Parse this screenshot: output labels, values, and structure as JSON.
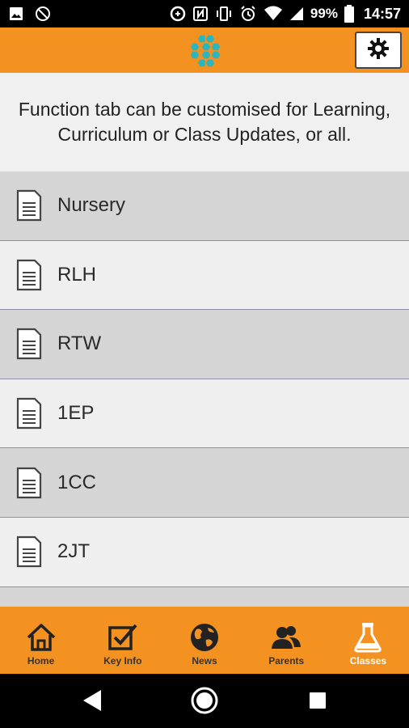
{
  "status_bar": {
    "battery_percent": "99%",
    "time": "14:57",
    "icons": [
      "image-icon",
      "rotation-lock-icon",
      "data-saver-icon",
      "nfc-icon",
      "vibrate-icon",
      "alarm-icon",
      "wifi-icon",
      "signal-icon",
      "battery-icon"
    ]
  },
  "header": {
    "logo": "hexagon-cluster-logo",
    "settings_icon": "gear-icon",
    "brand_color": "#f39221"
  },
  "banner": {
    "text": "Function tab can be customised for Learning, Curriculum or Class Updates, or all."
  },
  "classes": [
    {
      "label": "Nursery"
    },
    {
      "label": "RLH"
    },
    {
      "label": "RTW"
    },
    {
      "label": "1EP"
    },
    {
      "label": "1CC"
    },
    {
      "label": "2JT"
    }
  ],
  "nav": {
    "items": [
      {
        "label": "Home",
        "icon": "home-icon",
        "active": false
      },
      {
        "label": "Key Info",
        "icon": "checkbox-icon",
        "active": false
      },
      {
        "label": "News",
        "icon": "globe-icon",
        "active": false
      },
      {
        "label": "Parents",
        "icon": "people-icon",
        "active": false
      },
      {
        "label": "Classes",
        "icon": "flask-icon",
        "active": true
      }
    ]
  },
  "system_nav": {
    "buttons": [
      "back-icon",
      "home-circle-icon",
      "recents-icon"
    ]
  },
  "colors": {
    "accent": "#f39221",
    "row_dark": "#d5d5d5",
    "row_light": "#efefef",
    "logo_teal": "#2bb5bf"
  }
}
